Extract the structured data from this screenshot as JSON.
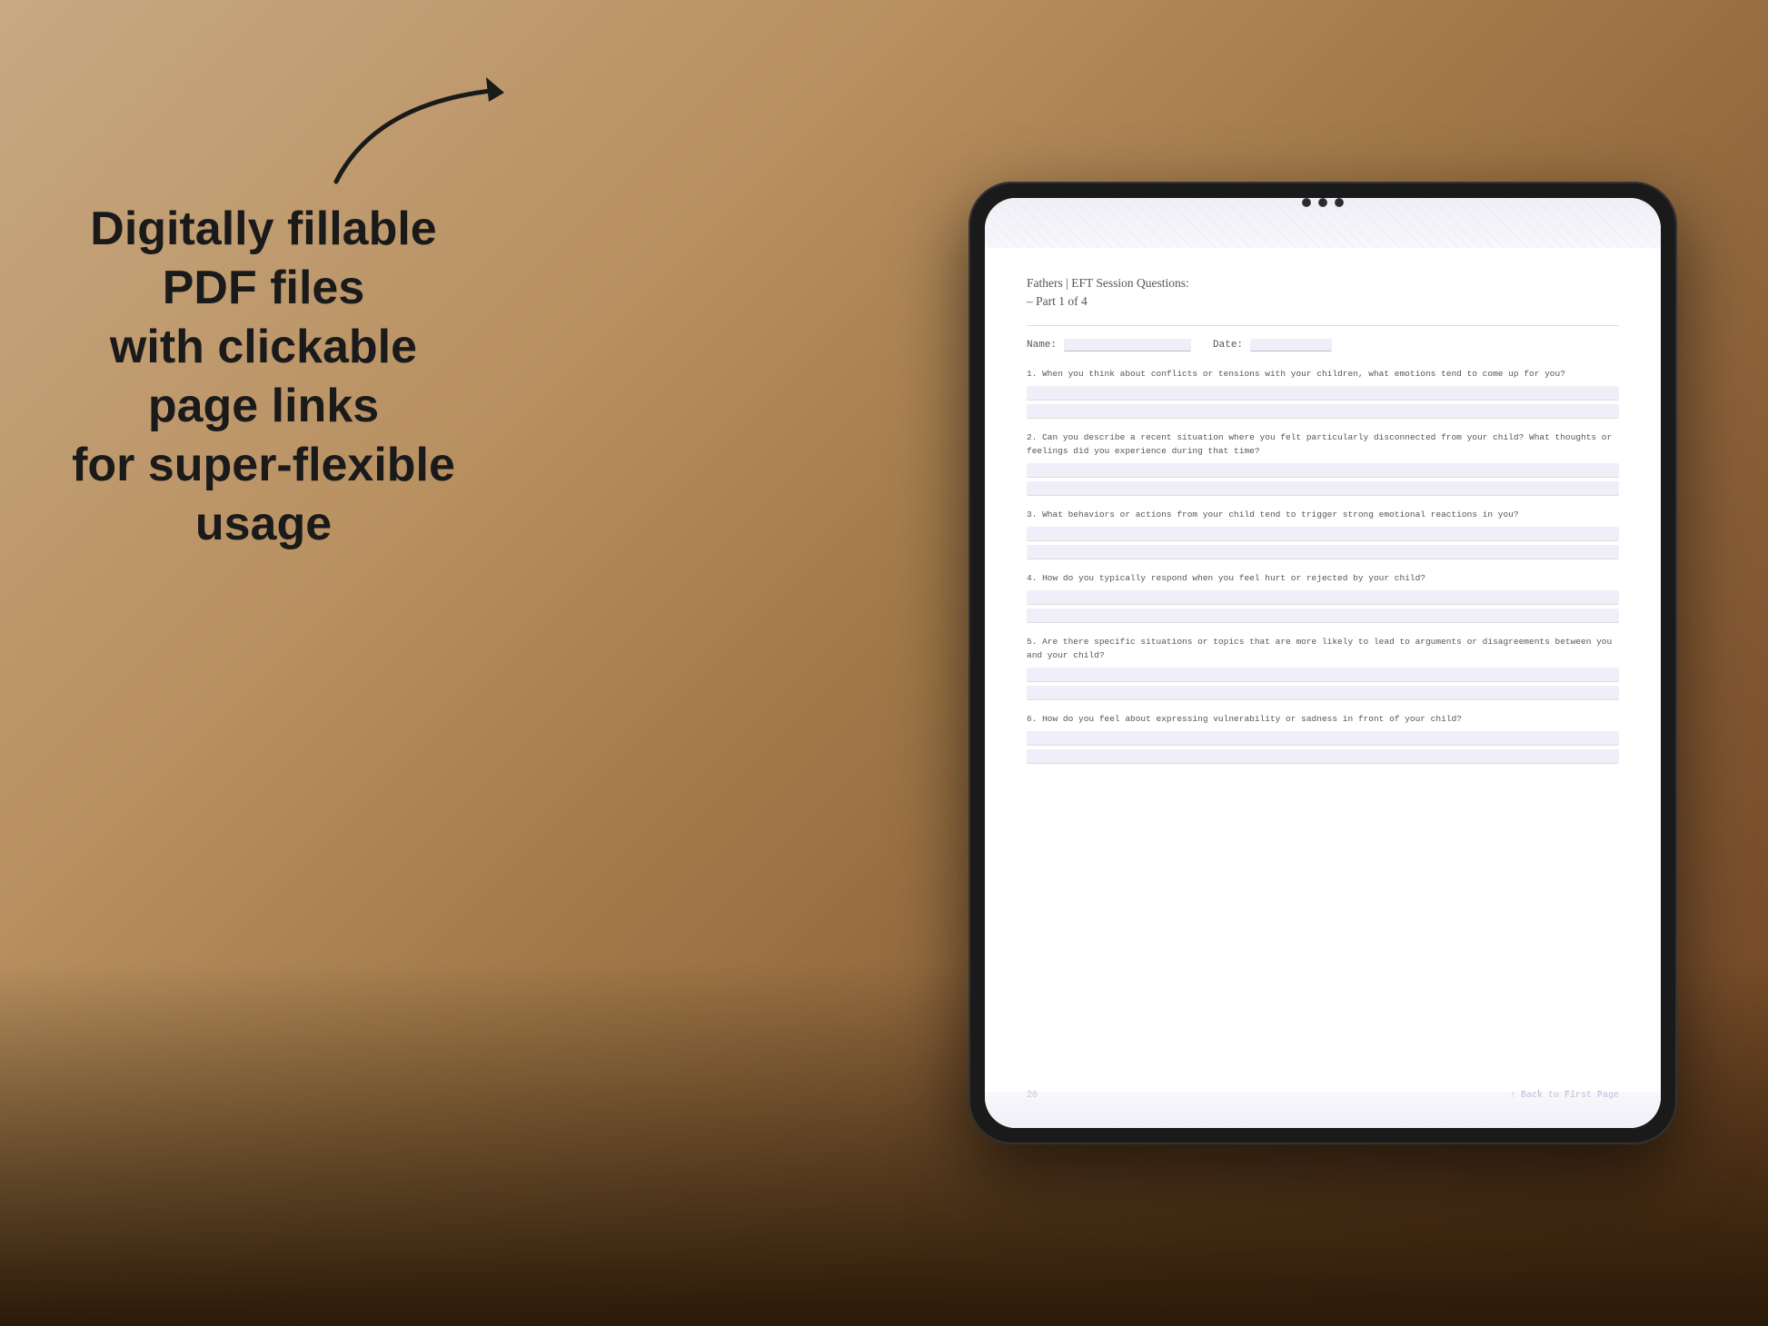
{
  "background": {
    "color_start": "#c8a882",
    "color_end": "#6a4020"
  },
  "left_text": {
    "line1": "Digitally fillable PDF files",
    "line2": "with clickable page links",
    "line3": "for super-flexible usage"
  },
  "arrow": {
    "description": "curved arrow pointing right toward tablet"
  },
  "tablet": {
    "camera_dots": 3
  },
  "pdf": {
    "title": "Fathers | EFT Session Questions:",
    "subtitle": "– Part 1 of 4",
    "name_label": "Name:",
    "date_label": "Date:",
    "page_number": "20",
    "back_link": "↑ Back to First Page",
    "questions": [
      {
        "number": "1.",
        "text": "When you think about conflicts or tensions with your children, what emotions tend to come up for you?"
      },
      {
        "number": "2.",
        "text": "Can you describe a recent situation where you felt particularly disconnected from your child? What thoughts or feelings did you experience during that time?"
      },
      {
        "number": "3.",
        "text": "What behaviors or actions from your child tend to trigger strong emotional reactions in you?"
      },
      {
        "number": "4.",
        "text": "How do you typically respond when you feel hurt or rejected by your child?"
      },
      {
        "number": "5.",
        "text": "Are there specific situations or topics that are more likely to lead to arguments or disagreements between you and your child?"
      },
      {
        "number": "6.",
        "text": "How do you feel about expressing vulnerability or sadness in front of your child?"
      }
    ]
  }
}
